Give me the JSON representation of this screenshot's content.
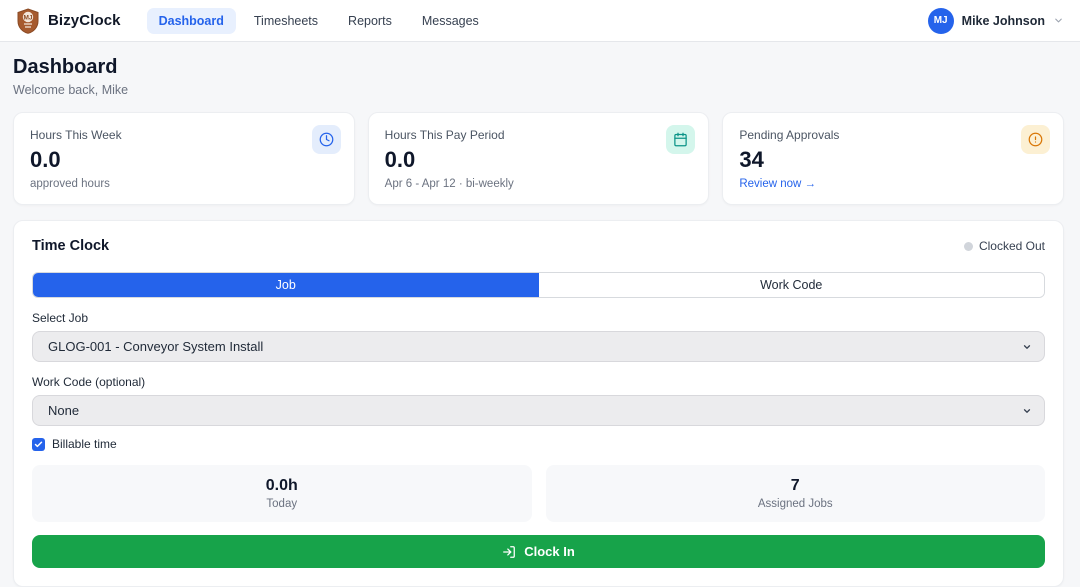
{
  "header": {
    "brand": "BizyClock",
    "nav": [
      {
        "label": "Dashboard",
        "active": true
      },
      {
        "label": "Timesheets",
        "active": false
      },
      {
        "label": "Reports",
        "active": false
      },
      {
        "label": "Messages",
        "active": false
      }
    ],
    "user": {
      "initials": "MJ",
      "name": "Mike Johnson"
    }
  },
  "page": {
    "title": "Dashboard",
    "subtitle": "Welcome back, Mike"
  },
  "stats": [
    {
      "label": "Hours This Week",
      "value": "0.0",
      "sub": "approved hours",
      "icon": "clock-icon",
      "icon_color": "#2563eb",
      "icon_bg": "#e4edfc"
    },
    {
      "label": "Hours This Pay Period",
      "value": "0.0",
      "sub": "Apr 6 - Apr 12 · bi-weekly",
      "icon": "calendar-icon",
      "icon_color": "#0d9488",
      "icon_bg": "#d4f6ec"
    },
    {
      "label": "Pending Approvals",
      "value": "34",
      "link": "Review now →",
      "icon": "alert-circle-icon",
      "icon_color": "#d97706",
      "icon_bg": "#fcf0d3"
    }
  ],
  "time_clock": {
    "title": "Time Clock",
    "status": "Clocked Out",
    "tabs": [
      {
        "label": "Job",
        "active": true
      },
      {
        "label": "Work Code",
        "active": false
      }
    ],
    "job_select": {
      "label": "Select Job",
      "value": "GLOG-001 - Conveyor System Install"
    },
    "work_code_select": {
      "label": "Work Code (optional)",
      "value": "None"
    },
    "billable": {
      "label": "Billable time",
      "checked": true
    },
    "summary": [
      {
        "value": "0.0h",
        "label": "Today"
      },
      {
        "value": "7",
        "label": "Assigned Jobs"
      }
    ],
    "clock_in_label": "Clock In"
  },
  "colors": {
    "accent_blue": "#2563eb",
    "button_green": "#17a34a",
    "status_dot_gray": "#d1d5db"
  }
}
